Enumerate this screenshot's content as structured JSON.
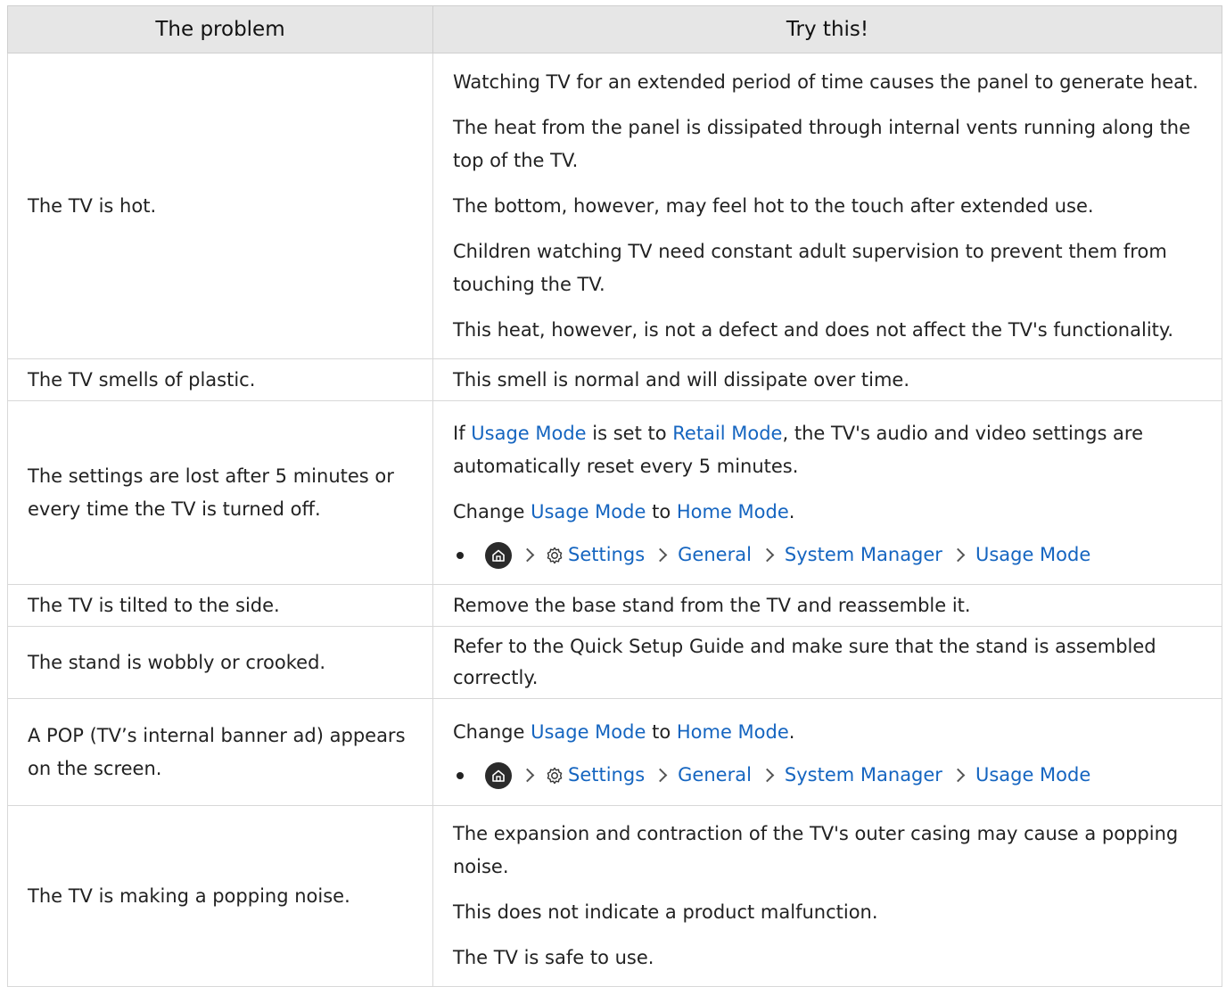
{
  "table": {
    "header_problem": "The problem",
    "header_try": "Try this!"
  },
  "rows": [
    {
      "problem": "The TV is hot.",
      "paragraphs": [
        "Watching TV for an extended period of time causes the panel to generate heat.",
        "The heat from the panel is dissipated through internal vents running along the top of the TV.",
        "The bottom, however, may feel hot to the touch after extended use.",
        "Children watching TV need constant adult supervision to prevent them from touching the TV.",
        "This heat, however, is not a defect and does not affect the TV's functionality."
      ]
    },
    {
      "problem": "The TV smells of plastic.",
      "paragraphs": [
        "This smell is normal and will dissipate over time."
      ]
    },
    {
      "problem": "The settings are lost after 5 minutes or every time the TV is turned off.",
      "p1_a": "If ",
      "p1_link1": "Usage Mode",
      "p1_b": " is set to ",
      "p1_link2": "Retail Mode",
      "p1_c": ", the TV's audio and video settings are automatically reset every 5 minutes.",
      "p2_a": "Change ",
      "p2_link1": "Usage Mode",
      "p2_b": " to ",
      "p2_link2": "Home Mode",
      "p2_c": ".",
      "path": [
        "Settings",
        "General",
        "System Manager",
        "Usage Mode"
      ]
    },
    {
      "problem": "The TV is tilted to the side.",
      "paragraphs": [
        "Remove the base stand from the TV and reassemble it."
      ]
    },
    {
      "problem": "The stand is wobbly or crooked.",
      "paragraphs": [
        "Refer to the Quick Setup Guide and make sure that the stand is assembled correctly."
      ]
    },
    {
      "problem": "A POP (TV’s internal banner ad) appears on the screen.",
      "p2_a": "Change ",
      "p2_link1": "Usage Mode",
      "p2_b": " to ",
      "p2_link2": "Home Mode",
      "p2_c": ".",
      "path": [
        "Settings",
        "General",
        "System Manager",
        "Usage Mode"
      ]
    },
    {
      "problem": "The TV is making a popping noise.",
      "paragraphs": [
        "The expansion and contraction of the TV's outer casing may cause a popping noise.",
        "This does not indicate a product malfunction.",
        "The TV is safe to use."
      ]
    }
  ],
  "colors": {
    "link": "#1565c0",
    "header_bg": "#e6e6e6"
  },
  "icons": {
    "home": "home-icon",
    "settings": "gear-icon",
    "separator": "chevron-right-icon"
  }
}
